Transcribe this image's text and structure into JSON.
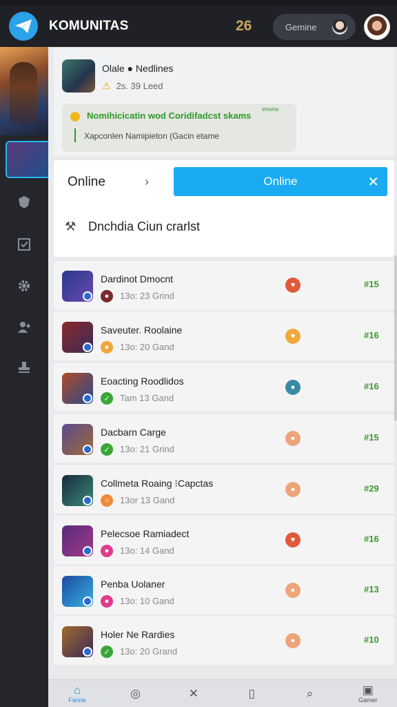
{
  "status_bar": {
    "time": "",
    "right": ""
  },
  "header": {
    "title": "KOMUNITAS",
    "coins": "26",
    "profile_label": "Gemine"
  },
  "news": {
    "title": "Olale ● Nedlines",
    "meta": "2s. 39  Leed",
    "notice_title": "Nomihicicatin wod Coridifadcst skams",
    "notice_badge": "eheme",
    "notice_body": "Xapconlen Namipieton (Gacin etame"
  },
  "tabs": {
    "inactive_label": "Online",
    "active_label": "Online",
    "section_title": "Dnchdia Ciun crarlst"
  },
  "list": [
    {
      "title": "Dardinot Dmocnt",
      "meta": "13o: 23 Grind",
      "rank": "#15",
      "status_color": "#7a2a2a",
      "status_glyph": "●",
      "react_color": "#e05a3a",
      "react_glyph": "♥",
      "thumb_a": "#2a3a8a",
      "thumb_b": "#6a4ab0"
    },
    {
      "title": "Saveuter. Roolaine",
      "meta": "13o: 20 Gand",
      "rank": "#16",
      "status_color": "#f0a83a",
      "status_glyph": "●",
      "react_color": "#f0a83a",
      "react_glyph": "♥",
      "thumb_a": "#8a2a2a",
      "thumb_b": "#3a2a5a"
    },
    {
      "title": "Eoacting Roodlidos",
      "meta": "Tam 13 Gand",
      "rank": "#16",
      "status_color": "#3aa63a",
      "status_glyph": "✓",
      "react_color": "#3a8aa6",
      "react_glyph": "●",
      "thumb_a": "#b04a2a",
      "thumb_b": "#2a4a8a"
    },
    {
      "title": "Dacbarn Carge",
      "meta": "13o: 21 Grind",
      "rank": "#15",
      "status_color": "#3aa63a",
      "status_glyph": "✓",
      "react_color": "#eda57a",
      "react_glyph": "●",
      "thumb_a": "#5a4a8a",
      "thumb_b": "#a06a3a"
    },
    {
      "title": "Collmeta Roaing ⁝Capctas",
      "meta": "13or 13 Gand",
      "rank": "#29",
      "status_color": "#f08a3a",
      "status_glyph": "○",
      "react_color": "#eda57a",
      "react_glyph": "●",
      "thumb_a": "#1a2a3a",
      "thumb_b": "#3a8a7a"
    },
    {
      "title": "Pelecsoe Ramiadect",
      "meta": "13o: 14 Gand",
      "rank": "#16",
      "status_color": "#e03a8a",
      "status_glyph": "●",
      "react_color": "#e05a3a",
      "react_glyph": "♥",
      "thumb_a": "#5a2a7a",
      "thumb_b": "#a03a8a"
    },
    {
      "title": "Penba Uolaner",
      "meta": "13o: 10 Gand",
      "rank": "#13",
      "status_color": "#e03a8a",
      "status_glyph": "●",
      "react_color": "#eda57a",
      "react_glyph": "●",
      "thumb_a": "#1a4aa0",
      "thumb_b": "#3ab0e0"
    },
    {
      "title": "Holer Ne Rardies",
      "meta": "13o: 20 Grand",
      "rank": "#10",
      "status_color": "#3aa63a",
      "status_glyph": "✓",
      "react_color": "#eda57a",
      "react_glyph": "●",
      "thumb_a": "#a06a2a",
      "thumb_b": "#3a2a5a"
    }
  ],
  "bottom_nav": [
    {
      "label": "Fanne",
      "icon": "home-icon",
      "glyph": "⌂",
      "active": true
    },
    {
      "label": "",
      "icon": "compass-icon",
      "glyph": "◎",
      "active": false
    },
    {
      "label": "",
      "icon": "sword-icon",
      "glyph": "✕",
      "active": false
    },
    {
      "label": "",
      "icon": "bookmark-icon",
      "glyph": "▯",
      "active": false
    },
    {
      "label": "",
      "icon": "search-icon",
      "glyph": "⌕",
      "active": false
    },
    {
      "label": "Gamer",
      "icon": "gamer-icon",
      "glyph": "▣",
      "active": false
    }
  ],
  "colors": {
    "accent": "#19aaf2",
    "rank_green": "#3a9a2a",
    "header_bg": "#1f2126"
  }
}
